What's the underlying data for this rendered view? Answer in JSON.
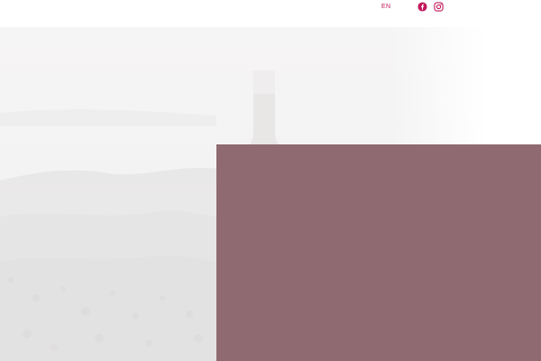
{
  "header": {
    "language_label": "EN"
  },
  "icons": {
    "facebook": "facebook-icon",
    "instagram": "instagram-icon"
  },
  "colors": {
    "accent": "#c2185b",
    "panel": "#8f6a70",
    "background": "#ffffff"
  }
}
